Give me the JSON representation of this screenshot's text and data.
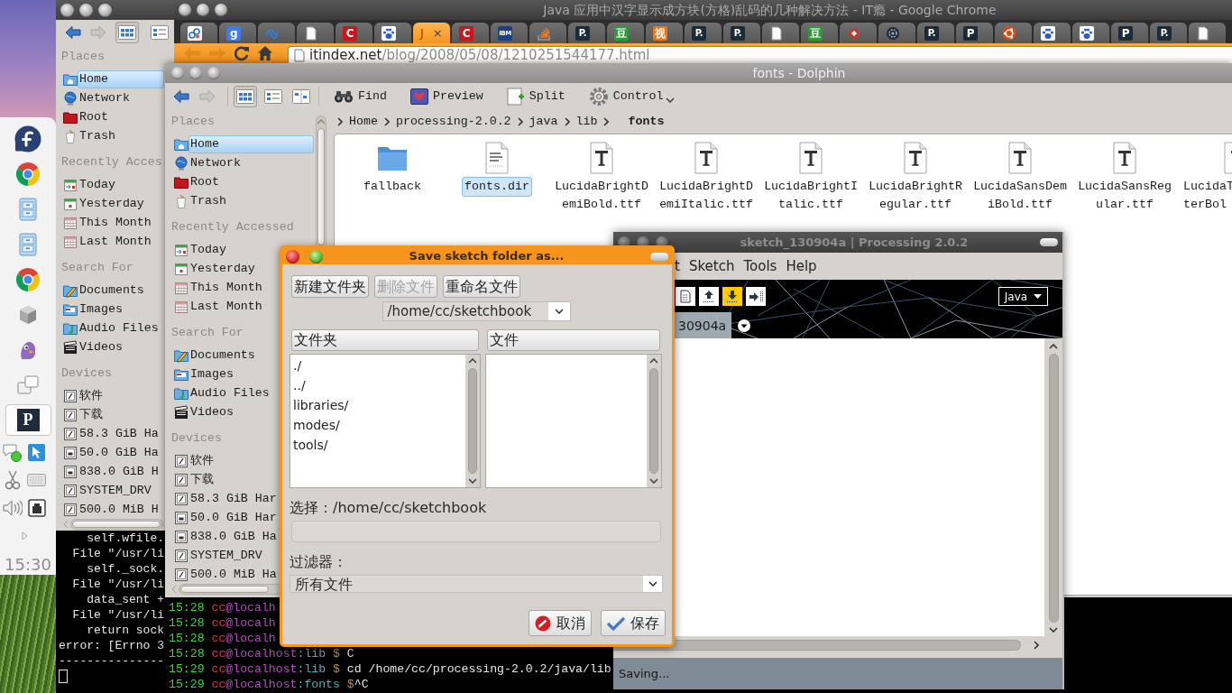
{
  "taskbar": {
    "launchers": [
      {
        "kind": "fedora",
        "selected": false
      },
      {
        "kind": "chrome",
        "selected": false
      },
      {
        "kind": "cabinet",
        "selected": false
      },
      {
        "kind": "cabinet",
        "selected": false
      },
      {
        "kind": "chrome",
        "selected": false
      },
      {
        "kind": "cube",
        "selected": false
      },
      {
        "kind": "pidgin",
        "selected": false
      },
      {
        "kind": "windows",
        "selected": false
      },
      {
        "kind": "processing",
        "glyph": "P",
        "selected": true
      }
    ],
    "tray": [
      {
        "kind": "chat"
      },
      {
        "kind": "cursor"
      },
      {
        "kind": "scissors"
      },
      {
        "kind": "keyboard"
      },
      {
        "kind": "speaker"
      },
      {
        "kind": "network"
      },
      {
        "kind": "expand"
      }
    ],
    "clock": "15:30"
  },
  "back_window": {
    "nav": [
      {
        "kind": "back",
        "disabled": false
      },
      {
        "kind": "forward",
        "disabled": true
      }
    ],
    "views": [
      {
        "kind": "icons",
        "selected": true
      },
      {
        "kind": "details",
        "selected": false
      }
    ],
    "places": [
      {
        "title": "Places",
        "items": [
          {
            "label": "Home",
            "kind": "home",
            "selected": true
          },
          {
            "label": "Network",
            "kind": "network",
            "selected": false
          },
          {
            "label": "Root",
            "kind": "root",
            "selected": false
          },
          {
            "label": "Trash",
            "kind": "trash",
            "selected": false
          }
        ]
      },
      {
        "title": "Recently Acces",
        "items": [
          {
            "label": "Today",
            "kind": "today",
            "selected": false
          },
          {
            "label": "Yesterday",
            "kind": "yesterday",
            "selected": false
          },
          {
            "label": "This Month",
            "kind": "month",
            "selected": false
          },
          {
            "label": "Last Month",
            "kind": "month",
            "selected": false
          }
        ]
      },
      {
        "title": "Search For",
        "items": [
          {
            "label": "Documents",
            "kind": "documents",
            "selected": false
          },
          {
            "label": "Images",
            "kind": "images",
            "selected": false
          },
          {
            "label": "Audio Files",
            "kind": "audio",
            "selected": false
          },
          {
            "label": "Videos",
            "kind": "videos",
            "selected": false
          }
        ]
      },
      {
        "title": "Devices",
        "items": [
          {
            "label": "软件",
            "kind": "drive",
            "selected": false
          },
          {
            "label": "下载",
            "kind": "drive",
            "selected": false
          },
          {
            "label": "58.3 GiB Ha",
            "kind": "drive",
            "selected": false
          },
          {
            "label": "50.0 GiB Ha",
            "kind": "disk",
            "selected": false
          },
          {
            "label": "838.0 GiB H",
            "kind": "disk",
            "selected": false
          },
          {
            "label": "SYSTEM_DRV",
            "kind": "drive",
            "selected": false
          },
          {
            "label": "500.0 MiB H",
            "kind": "drive",
            "selected": false
          }
        ]
      }
    ],
    "terminal": [
      "    self.wfile.",
      "  File \"/usr/li",
      "    self._sock.",
      "  File \"/usr/li",
      "    data_sent +",
      "  File \"/usr/li",
      "    return sock",
      "error: [Errno 3",
      "---------------"
    ]
  },
  "browser": {
    "title": "Java 应用中汉字显示成方块(方格)乱码的几种解决方法 - IT瘾 - Google Chrome",
    "tabs": [
      {
        "kind": "circles",
        "selected": false
      },
      {
        "kind": "glyph",
        "glyph": "g",
        "color": "#3b7de9",
        "selected": false
      },
      {
        "kind": "wave",
        "selected": false
      },
      {
        "kind": "page",
        "selected": false
      },
      {
        "kind": "glyph",
        "glyph": "C",
        "color": "#c8161d",
        "selected": false
      },
      {
        "kind": "paw",
        "selected": false
      },
      {
        "kind": "text",
        "label": "J",
        "close": "×",
        "selected": true
      },
      {
        "kind": "glyph",
        "glyph": "C",
        "color": "#c8161d",
        "selected": false
      },
      {
        "kind": "glyph",
        "glyph": "IBM",
        "color": "#1f3f7f",
        "selected": false
      },
      {
        "kind": "stack",
        "selected": false
      },
      {
        "kind": "glyph",
        "glyph": "P.",
        "color": "#1c2b3a",
        "selected": false
      },
      {
        "kind": "glyph",
        "glyph": "豆",
        "color": "#2f9a3c",
        "selected": false
      },
      {
        "kind": "glyph",
        "glyph": "视",
        "color": "#e8761e",
        "selected": false
      },
      {
        "kind": "glyph",
        "glyph": "P.",
        "color": "#1c2b3a",
        "selected": false
      },
      {
        "kind": "glyph",
        "glyph": "P.",
        "color": "#1c2b3a",
        "selected": false
      },
      {
        "kind": "page",
        "selected": false
      },
      {
        "kind": "glyph",
        "glyph": "豆",
        "color": "#2f9a3c",
        "selected": false
      },
      {
        "kind": "diamond",
        "selected": false
      },
      {
        "kind": "gear",
        "selected": false
      },
      {
        "kind": "glyph",
        "glyph": "P.",
        "color": "#1c2b3a",
        "selected": false
      },
      {
        "kind": "glyph",
        "glyph": "P",
        "color": "#1c2b3a",
        "selected": false
      },
      {
        "kind": "ubuntu",
        "selected": false
      },
      {
        "kind": "paw",
        "selected": false
      },
      {
        "kind": "paw",
        "selected": false
      },
      {
        "kind": "glyph",
        "glyph": "P",
        "color": "#1c2b3a",
        "selected": false
      },
      {
        "kind": "glyph",
        "glyph": "P.",
        "color": "#1c2b3a",
        "selected": false
      },
      {
        "kind": "page",
        "selected": false
      }
    ],
    "nav": [
      {
        "kind": "back",
        "disabled": true
      },
      {
        "kind": "forward",
        "disabled": true
      },
      {
        "kind": "reload",
        "disabled": false
      },
      {
        "kind": "home",
        "disabled": false
      }
    ],
    "url": "**itindex.net**/blog/2008/05/08/1210251544177.html"
  },
  "dolphin": {
    "title": "fonts - Dolphin",
    "nav": [
      {
        "kind": "back",
        "disabled": false
      },
      {
        "kind": "forward",
        "disabled": true
      }
    ],
    "views": [
      {
        "kind": "icons",
        "selected": true
      },
      {
        "kind": "details",
        "selected": false
      },
      {
        "kind": "columns",
        "selected": false
      }
    ],
    "actions": [
      {
        "kind": "find",
        "label": "Find"
      },
      {
        "kind": "preview",
        "label": "Preview"
      },
      {
        "kind": "split",
        "label": "Split"
      },
      {
        "kind": "control",
        "label": "Control"
      }
    ],
    "breadcrumb": [
      {
        "label": "Home",
        "current": false
      },
      {
        "label": "processing-2.0.2",
        "current": false
      },
      {
        "label": "java",
        "current": false
      },
      {
        "label": "lib",
        "current": false
      },
      {
        "label": "fonts",
        "current": true
      }
    ],
    "places": [
      {
        "title": "Places",
        "items": [
          {
            "label": "Home",
            "kind": "home",
            "selected": true
          },
          {
            "label": "Network",
            "kind": "network",
            "selected": false
          },
          {
            "label": "Root",
            "kind": "root",
            "selected": false
          },
          {
            "label": "Trash",
            "kind": "trash",
            "selected": false
          }
        ]
      },
      {
        "title": "Recently Accessed",
        "items": [
          {
            "label": "Today",
            "kind": "today",
            "selected": false
          },
          {
            "label": "Yesterday",
            "kind": "yesterday",
            "selected": false
          },
          {
            "label": "This Month",
            "kind": "month",
            "selected": false
          },
          {
            "label": "Last Month",
            "kind": "month",
            "selected": false
          }
        ]
      },
      {
        "title": "Search For",
        "items": [
          {
            "label": "Documents",
            "kind": "documents",
            "selected": false
          },
          {
            "label": "Images",
            "kind": "images",
            "selected": false
          },
          {
            "label": "Audio Files",
            "kind": "audio",
            "selected": false
          },
          {
            "label": "Videos",
            "kind": "videos",
            "selected": false
          }
        ]
      },
      {
        "title": "Devices",
        "items": [
          {
            "label": "软件",
            "kind": "drive",
            "selected": false
          },
          {
            "label": "下载",
            "kind": "drive",
            "selected": false
          },
          {
            "label": "58.3 GiB Har",
            "kind": "drive",
            "selected": false
          },
          {
            "label": "50.0 GiB Har",
            "kind": "disk",
            "selected": false
          },
          {
            "label": "838.0 GiB Ha",
            "kind": "disk",
            "selected": false
          },
          {
            "label": "SYSTEM_DRV",
            "kind": "drive",
            "selected": false
          },
          {
            "label": "500.0 MiB Ha",
            "kind": "drive",
            "selected": false
          }
        ]
      }
    ],
    "files": [
      {
        "kind": "folder",
        "lines": [
          "fallback"
        ],
        "selected": false
      },
      {
        "kind": "text",
        "lines": [
          "fonts.dir"
        ],
        "selected": true
      },
      {
        "kind": "font",
        "lines": [
          "LucidaBrightD",
          "emiBold.ttf"
        ],
        "selected": false
      },
      {
        "kind": "font",
        "lines": [
          "LucidaBrightD",
          "emiItalic.ttf"
        ],
        "selected": false
      },
      {
        "kind": "font",
        "lines": [
          "LucidaBrightI",
          "talic.ttf"
        ],
        "selected": false
      },
      {
        "kind": "font",
        "lines": [
          "LucidaBrightR",
          "egular.ttf"
        ],
        "selected": false
      },
      {
        "kind": "font",
        "lines": [
          "LucidaSansDem",
          "iBold.ttf"
        ],
        "selected": false
      },
      {
        "kind": "font",
        "lines": [
          "LucidaSansReg",
          "ular.ttf"
        ],
        "selected": false
      },
      {
        "kind": "font",
        "lines": [
          "LucidaT",
          "terBol"
        ],
        "selected": false
      }
    ],
    "terminal": [
      {
        "parts": [
          {
            "kind": "time",
            "text": "15:28"
          },
          {
            "kind": "user",
            "text": " cc"
          },
          {
            "kind": "host",
            "text": "@localh"
          }
        ]
      },
      {
        "parts": [
          {
            "kind": "time",
            "text": "15:28"
          },
          {
            "kind": "user",
            "text": " cc"
          },
          {
            "kind": "host",
            "text": "@localh"
          }
        ]
      },
      {
        "parts": [
          {
            "kind": "time",
            "text": "15:28"
          },
          {
            "kind": "user",
            "text": " cc"
          },
          {
            "kind": "host",
            "text": "@localh"
          }
        ]
      },
      {
        "parts": [
          {
            "kind": "time",
            "text": "15:28"
          },
          {
            "kind": "user",
            "text": " cc"
          },
          {
            "kind": "host",
            "text": "@localhost"
          },
          {
            "kind": "path",
            "text": ":lib"
          },
          {
            "kind": "prompt",
            "text": " $"
          },
          {
            "kind": "command",
            "text": " C"
          }
        ]
      },
      {
        "parts": [
          {
            "kind": "time",
            "text": "15:29"
          },
          {
            "kind": "user",
            "text": " cc"
          },
          {
            "kind": "host",
            "text": "@localhost"
          },
          {
            "kind": "path",
            "text": ":lib"
          },
          {
            "kind": "prompt",
            "text": " $"
          },
          {
            "kind": "command",
            "text": " cd /home/cc/processing-2.0.2/java/lib"
          }
        ]
      },
      {
        "parts": [
          {
            "kind": "time",
            "text": "15:29"
          },
          {
            "kind": "user",
            "text": " cc"
          },
          {
            "kind": "host",
            "text": "@localhost"
          },
          {
            "kind": "path",
            "text": ":fonts"
          },
          {
            "kind": "prompt",
            "text": " $"
          },
          {
            "kind": "command",
            "text": "^C"
          }
        ]
      }
    ]
  },
  "sketch": {
    "title": "sketch_130904a | Processing 2.0.2",
    "menu": [
      "t",
      "Sketch",
      "Tools",
      "Help"
    ],
    "tools": [
      {
        "kind": "new",
        "active": false
      },
      {
        "kind": "open",
        "active": false
      },
      {
        "kind": "save",
        "active": true
      },
      {
        "kind": "export",
        "active": false
      }
    ],
    "mode": "Java",
    "tab": "30904a",
    "status": "Saving..."
  },
  "dialog": {
    "title": "Save sketch folder as...",
    "buttons": [
      {
        "label": "新建文件夹",
        "disabled": false
      },
      {
        "label": "删除文件",
        "disabled": true
      },
      {
        "label": "重命名文件",
        "disabled": false
      }
    ],
    "directory": "/home/cc/sketchbook",
    "folders_header": "文件夹",
    "files_header": "文件",
    "folders": [
      "./",
      "../",
      "libraries/",
      "modes/",
      "tools/"
    ],
    "selection": "选择：/home/cc/sketchbook",
    "filter_label": "过滤器：",
    "filter": "所有文件",
    "actions": [
      {
        "kind": "cancel",
        "label": "取消"
      },
      {
        "kind": "save",
        "label": "保存"
      }
    ]
  }
}
